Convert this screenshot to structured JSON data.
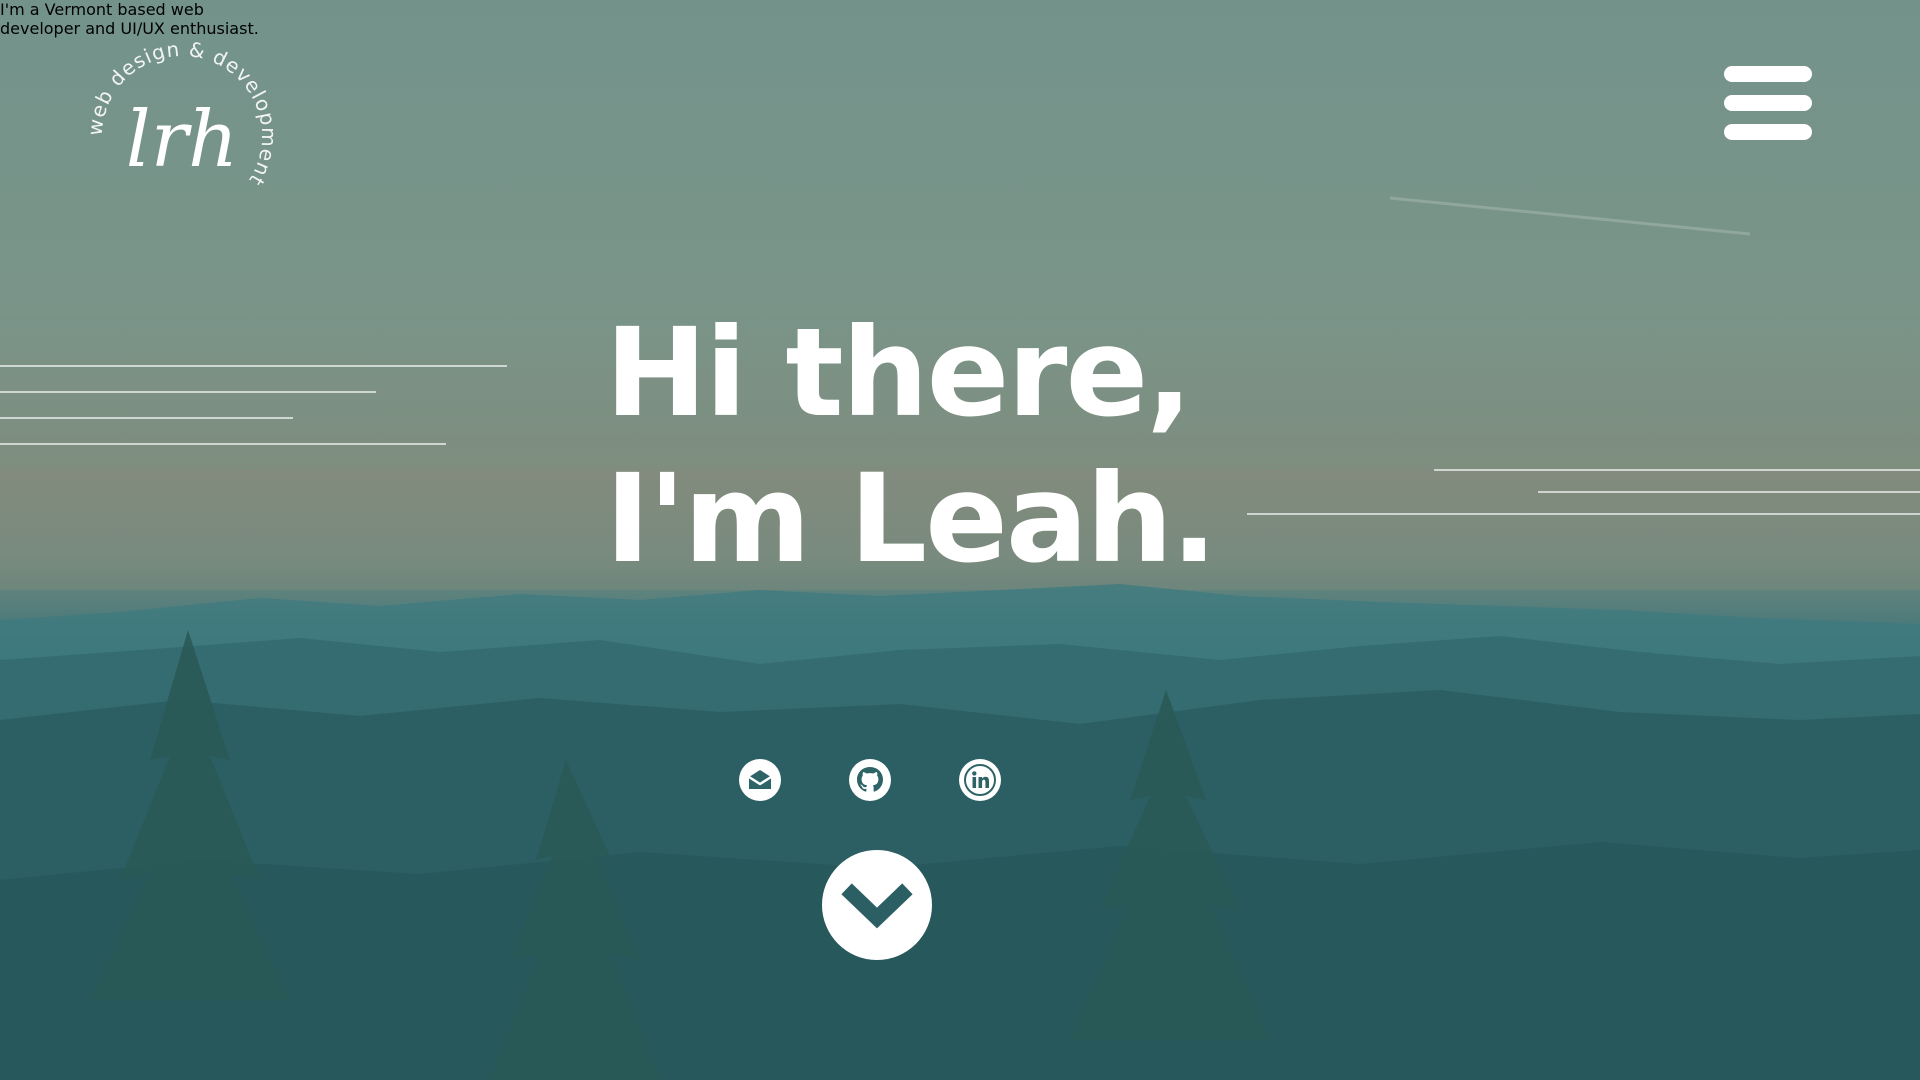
{
  "logo": {
    "monogram": "lrh",
    "ring_text": "web design & development"
  },
  "nav": {
    "menu_icon": "hamburger-menu-icon"
  },
  "hero": {
    "headline_line1": "Hi there,",
    "headline_line2": "I'm Leah.",
    "subtitle_line1": "I'm a Vermont based web",
    "subtitle_line2": "developer and UI/UX enthusiast."
  },
  "social": [
    {
      "icon": "email-icon"
    },
    {
      "icon": "github-icon"
    },
    {
      "icon": "linkedin-icon"
    }
  ],
  "scroll": {
    "icon": "chevron-down-icon"
  },
  "colors": {
    "text": "#ffffff",
    "sky": "#73938a",
    "mountains": "#2e6368",
    "forest": "#244f52"
  }
}
